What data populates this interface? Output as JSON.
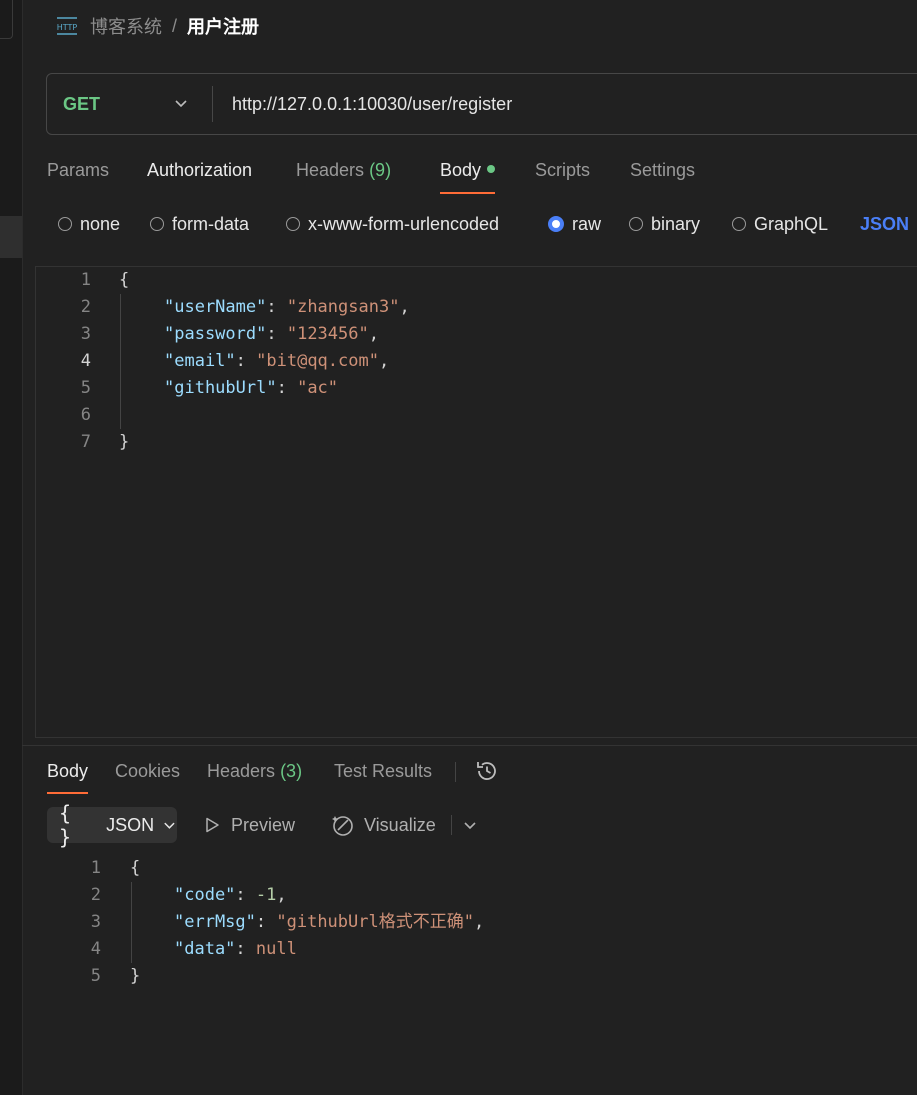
{
  "breadcrumb": {
    "icon": "http-icon",
    "parent": "博客系统",
    "separator": "/",
    "current": "用户注册"
  },
  "request": {
    "method": "GET",
    "url": "http://127.0.0.1:10030/user/register"
  },
  "request_tabs": [
    {
      "label": "Params"
    },
    {
      "label": "Authorization"
    },
    {
      "label": "Headers",
      "count": "(9)"
    },
    {
      "label": "Body",
      "active": true
    },
    {
      "label": "Scripts"
    },
    {
      "label": "Settings"
    }
  ],
  "body_types": [
    "none",
    "form-data",
    "x-www-form-urlencoded",
    "raw",
    "binary",
    "GraphQL"
  ],
  "body_type_selected": "raw",
  "body_language": "JSON",
  "request_body": {
    "line_numbers": [
      "1",
      "2",
      "3",
      "4",
      "5",
      "6",
      "7"
    ],
    "open_brace": "{",
    "close_brace": "}",
    "fields": [
      {
        "key": "\"userName\"",
        "value": "\"zhangsan3\"",
        "comma": ","
      },
      {
        "key": "\"password\"",
        "value": "\"123456\"",
        "comma": ","
      },
      {
        "key": "\"email\"",
        "value": "\"bit@qq.com\"",
        "comma": ","
      },
      {
        "key": "\"githubUrl\"",
        "value": "\"ac\"",
        "comma": ""
      }
    ]
  },
  "response_tabs": [
    {
      "label": "Body",
      "active": true
    },
    {
      "label": "Cookies"
    },
    {
      "label": "Headers",
      "count": "(3)"
    },
    {
      "label": "Test Results"
    }
  ],
  "response_toolbar": {
    "format": "JSON",
    "braces": "{ }",
    "preview": "Preview",
    "visualize": "Visualize"
  },
  "response_body": {
    "line_numbers": [
      "1",
      "2",
      "3",
      "4",
      "5"
    ],
    "open_brace": "{",
    "close_brace": "}",
    "fields": [
      {
        "key": "\"code\"",
        "value": "-1",
        "comma": ","
      },
      {
        "key": "\"errMsg\"",
        "value": "\"githubUrl格式不正确\"",
        "comma": ","
      },
      {
        "key": "\"data\"",
        "value": "null",
        "comma": ""
      }
    ]
  },
  "colors": {
    "accent_tab": "#ff6c37",
    "method_green": "#6bc785",
    "radio_blue": "#4a7ff7",
    "json_key": "#9cdcfe",
    "json_string": "#ce9178"
  }
}
